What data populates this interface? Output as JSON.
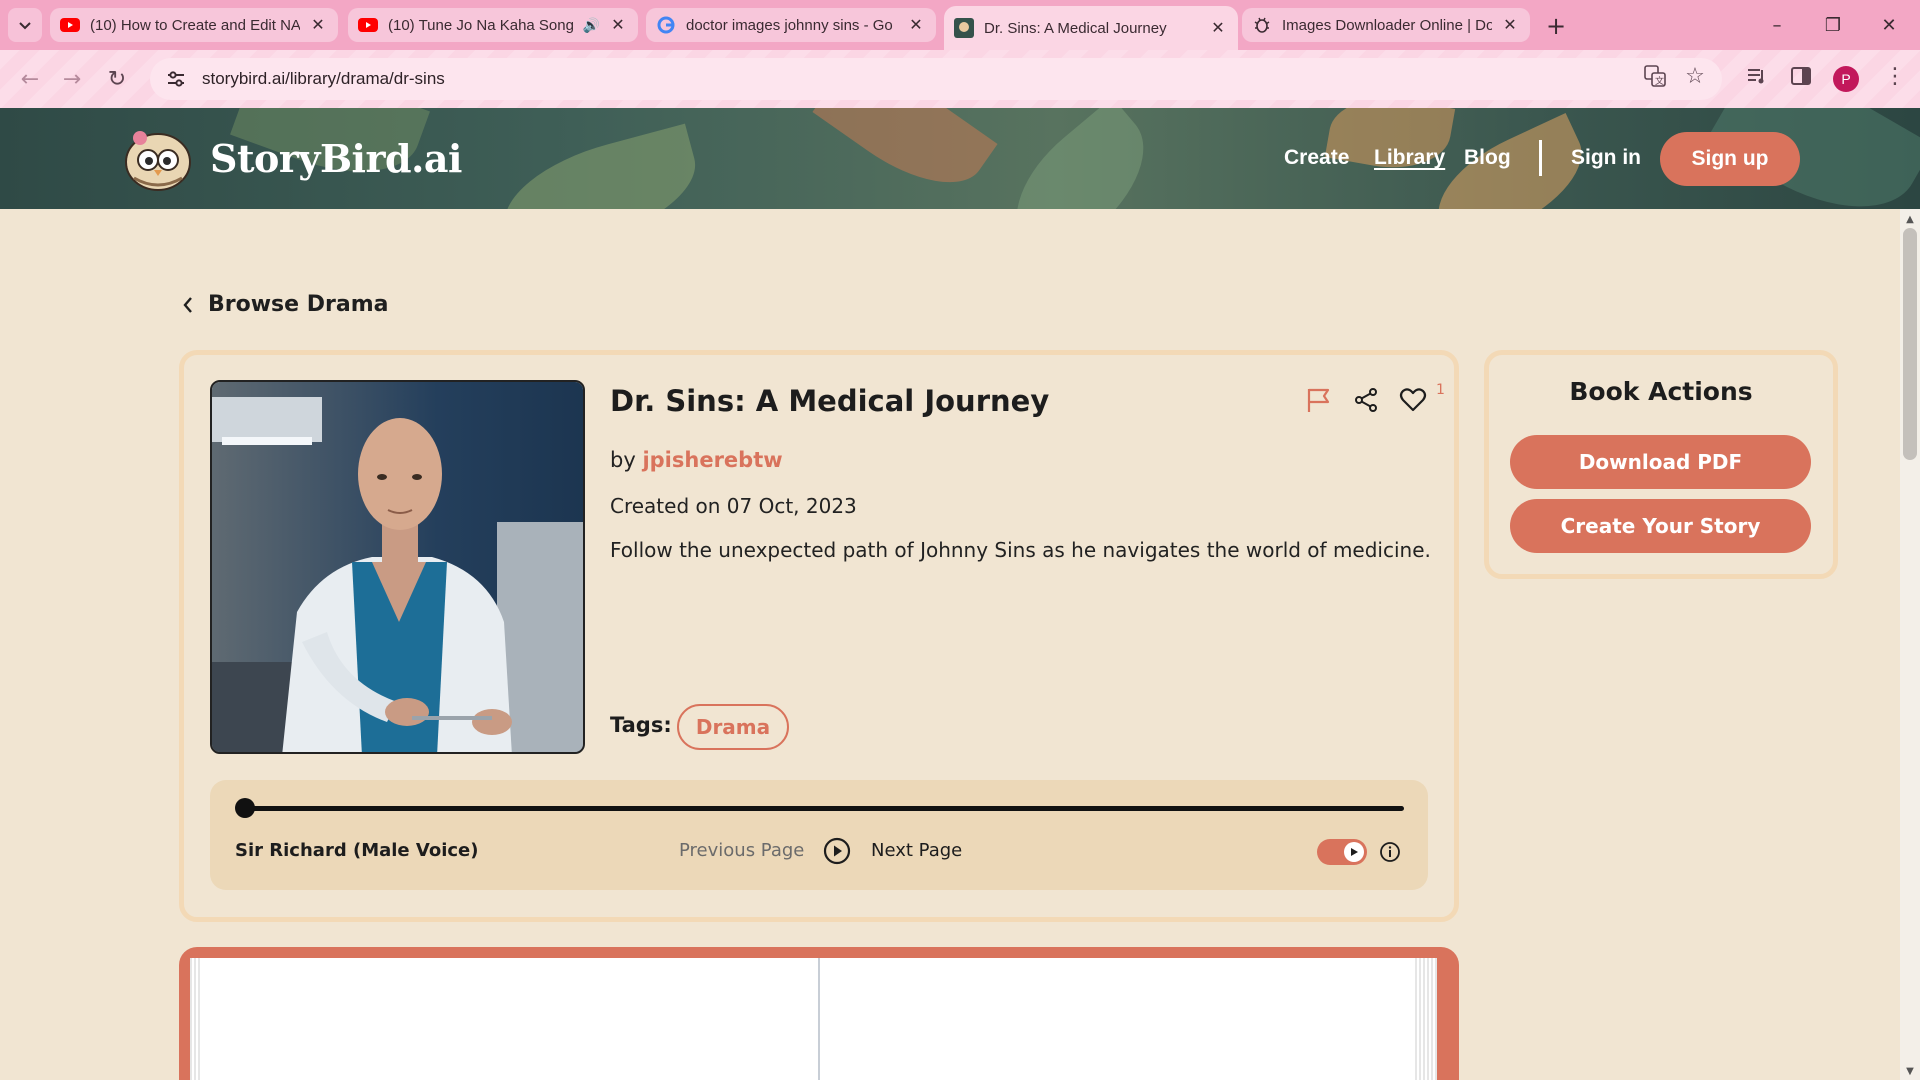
{
  "browser": {
    "tabs": [
      {
        "title": "(10) How to Create and Edit NA",
        "favicon": "youtube-icon"
      },
      {
        "title": "(10) Tune Jo Na Kaha Song",
        "favicon": "youtube-icon",
        "audio": true
      },
      {
        "title": "doctor images johnny sins - Go",
        "favicon": "google-icon"
      },
      {
        "title": "Dr. Sins: A Medical Journey",
        "favicon": "storybird-icon",
        "active": true
      },
      {
        "title": "Images Downloader Online | Do",
        "favicon": "bug-icon"
      }
    ],
    "url": "storybird.ai/library/drama/dr-sins",
    "profile_initial": "P",
    "colors": {
      "chrome": "#f3a7c5",
      "active_tab": "#fbd6e4"
    }
  },
  "site": {
    "brand": "StoryBird.ai",
    "nav": {
      "create": "Create",
      "library": "Library",
      "blog": "Blog",
      "signin": "Sign in",
      "signup": "Sign up"
    },
    "accent": "#d9735c"
  },
  "breadcrumb": {
    "label": "Browse Drama"
  },
  "book": {
    "title": "Dr. Sins: A Medical Journey",
    "by": "by",
    "author": "jpisherebtw",
    "created": "Created on 07 Oct, 2023",
    "description": "Follow the unexpected path of Johnny Sins as he navigates the world of medicine.",
    "tags_label": "Tags:",
    "tags": [
      "Drama"
    ],
    "like_count": "1"
  },
  "player": {
    "voice": "Sir Richard (Male Voice)",
    "previous": "Previous Page",
    "next": "Next Page",
    "progress": 0,
    "autoplay_on": true
  },
  "actions": {
    "title": "Book Actions",
    "download": "Download PDF",
    "create": "Create Your Story"
  }
}
